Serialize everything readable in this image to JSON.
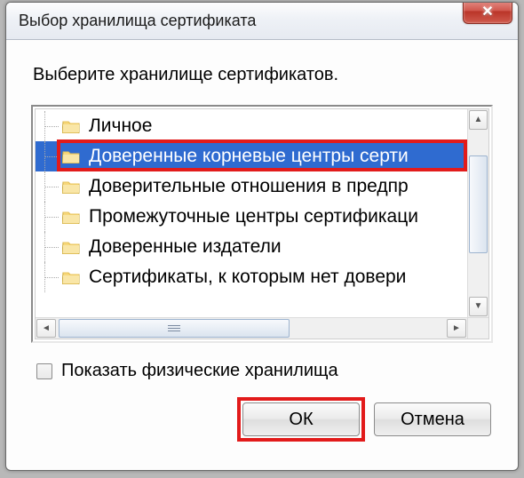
{
  "window": {
    "title": "Выбор хранилища сертификата"
  },
  "instruction": "Выберите хранилище сертификатов.",
  "tree": {
    "items": [
      {
        "label": "Личное",
        "selected": false
      },
      {
        "label": "Доверенные корневые центры серти",
        "selected": true
      },
      {
        "label": "Доверительные отношения в предпр",
        "selected": false
      },
      {
        "label": "Промежуточные центры сертификаци",
        "selected": false
      },
      {
        "label": "Доверенные издатели",
        "selected": false
      },
      {
        "label": "Сертификаты, к которым нет довери",
        "selected": false
      }
    ]
  },
  "checkbox": {
    "label": "Показать физические хранилища",
    "checked": false
  },
  "buttons": {
    "ok": "ОК",
    "cancel": "Отмена"
  },
  "highlights": {
    "selected_item_index": 1,
    "ok_button": true
  },
  "colors": {
    "highlight": "#e21b1b",
    "selection": "#2f6bd0"
  }
}
